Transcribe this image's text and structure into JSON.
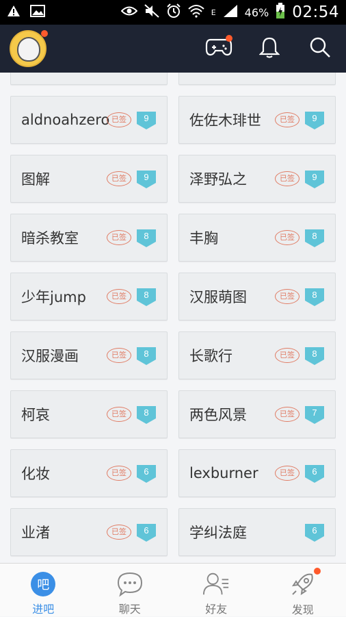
{
  "status_bar": {
    "battery": "46%",
    "time": "02:54",
    "network": "E"
  },
  "app_bar": {
    "avatar_has_badge": true,
    "game_has_badge": true
  },
  "stamp_text": "已签",
  "forums": [
    {
      "name": "aldnoahzero",
      "signed": true,
      "level": "9"
    },
    {
      "name": "佐佐木琲世",
      "signed": true,
      "level": "9"
    },
    {
      "name": "图解",
      "signed": true,
      "level": "9"
    },
    {
      "name": "泽野弘之",
      "signed": true,
      "level": "9"
    },
    {
      "name": "暗杀教室",
      "signed": true,
      "level": "8"
    },
    {
      "name": "丰胸",
      "signed": true,
      "level": "8"
    },
    {
      "name": "少年jump",
      "signed": true,
      "level": "8"
    },
    {
      "name": "汉服萌图",
      "signed": true,
      "level": "8"
    },
    {
      "name": "汉服漫画",
      "signed": true,
      "level": "8"
    },
    {
      "name": "长歌行",
      "signed": true,
      "level": "8"
    },
    {
      "name": "柯哀",
      "signed": true,
      "level": "8"
    },
    {
      "name": "两色风景",
      "signed": true,
      "level": "7"
    },
    {
      "name": "化妆",
      "signed": true,
      "level": "6"
    },
    {
      "name": "lexburner",
      "signed": true,
      "level": "6"
    },
    {
      "name": "业渚",
      "signed": true,
      "level": "6"
    },
    {
      "name": "学纠法庭",
      "signed": false,
      "level": "6"
    }
  ],
  "bottom_nav": {
    "tabs": [
      {
        "label": "进吧",
        "icon_glyph": "吧",
        "active": true
      },
      {
        "label": "聊天",
        "active": false
      },
      {
        "label": "好友",
        "active": false
      },
      {
        "label": "发现",
        "active": false,
        "has_badge": true
      }
    ]
  },
  "colors": {
    "accent": "#3b8fe6",
    "level_badge": "#5fc4d8",
    "stamp": "#e07b63",
    "badge_dot": "#ff5a2c",
    "appbar": "#1e2433"
  }
}
